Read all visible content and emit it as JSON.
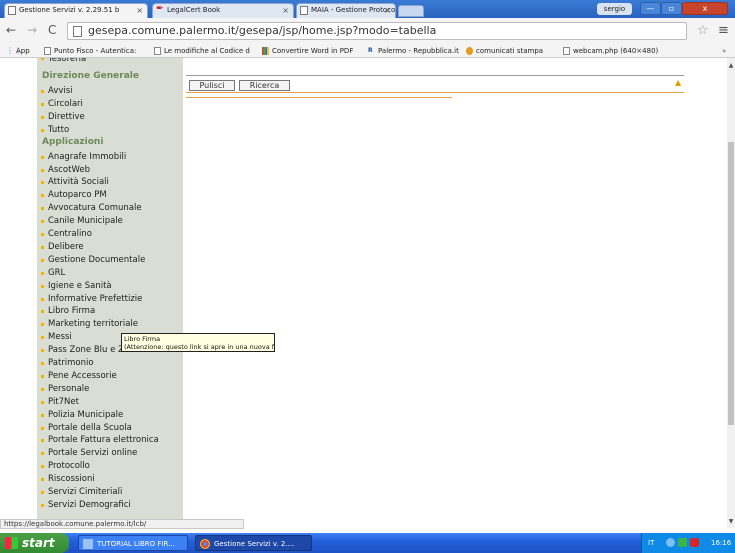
{
  "browser": {
    "tabs": [
      {
        "title": "Gestione Servizi v. 2.29.51 b",
        "active": true
      },
      {
        "title": "LegalCert Book",
        "active": false
      },
      {
        "title": "MAIA - Gestione Protocollo In",
        "active": false
      }
    ],
    "user": "sergio",
    "window_controls": {
      "minimize": "—",
      "maximize": "▫",
      "close": "x"
    },
    "url": "gesepa.comune.palermo.it/gesepa/jsp/home.jsp?modo=tabella",
    "bookmarks": [
      {
        "label": "App"
      },
      {
        "label": "Punto Fisco - Autentica:"
      },
      {
        "label": "Le modifiche al Codice d"
      },
      {
        "label": "Convertire Word in PDF"
      },
      {
        "label": "Palermo - Repubblica.it"
      },
      {
        "label": "comunicati stampa"
      },
      {
        "label": "webcam.php (640×480)"
      }
    ],
    "bookmarks_more": "»",
    "status_url": "https://legalbook.comune.palermo.it/lcb/"
  },
  "sidebar": {
    "top_cut_item": "Tesoreria",
    "sections": [
      {
        "heading": "Direzione Generale",
        "items": [
          "Avvisi",
          "Circolari",
          "Direttive",
          "Tutto"
        ]
      },
      {
        "heading": "Applicazioni",
        "items": [
          "Anagrafe Immobili",
          "AscotWeb",
          "Attività Sociali",
          "Autoparco PM",
          "Avvocatura Comunale",
          "Canile Municipale",
          "Centralino",
          "Delibere",
          "Gestione Documentale",
          "GRL",
          "Igiene e Sanità",
          "Informative Prefettizie",
          "Libro Firma",
          "Marketing territoriale",
          "Messi",
          "Pass Zone Blu e ZTL",
          "Patrimonio",
          "Pene Accessorie",
          "Personale",
          "Pit7Net",
          "Polizia Municipale",
          "Portale della Scuola",
          "Portale Fattura elettronica",
          "Portale Servizi online",
          "Protocollo",
          "Riscossioni",
          "Servizi Cimiteriali",
          "Servizi Demografici"
        ]
      }
    ]
  },
  "main": {
    "buttons": {
      "clear": "Pulisci",
      "search": "Ricerca"
    },
    "collapse_symbol": "▲"
  },
  "tooltip": {
    "line1": "Libro Firma",
    "line2": "(Attenzione: questo link si apre in una nuova finestra)"
  },
  "taskbar": {
    "start_label": "start",
    "tasks": [
      "TUTORIAL LIBRO FIR...",
      "Gestione Servizi v. 2...."
    ],
    "language": "IT",
    "clock": "16:16"
  },
  "colors": {
    "sidebar_bg": "#d9ddd3",
    "sidebar_heading": "#6b8a5c",
    "bullet": "#e6b800",
    "accent_line": "#e2a24a",
    "taskbar": "#245edb",
    "start_green": "#3c9a39"
  }
}
